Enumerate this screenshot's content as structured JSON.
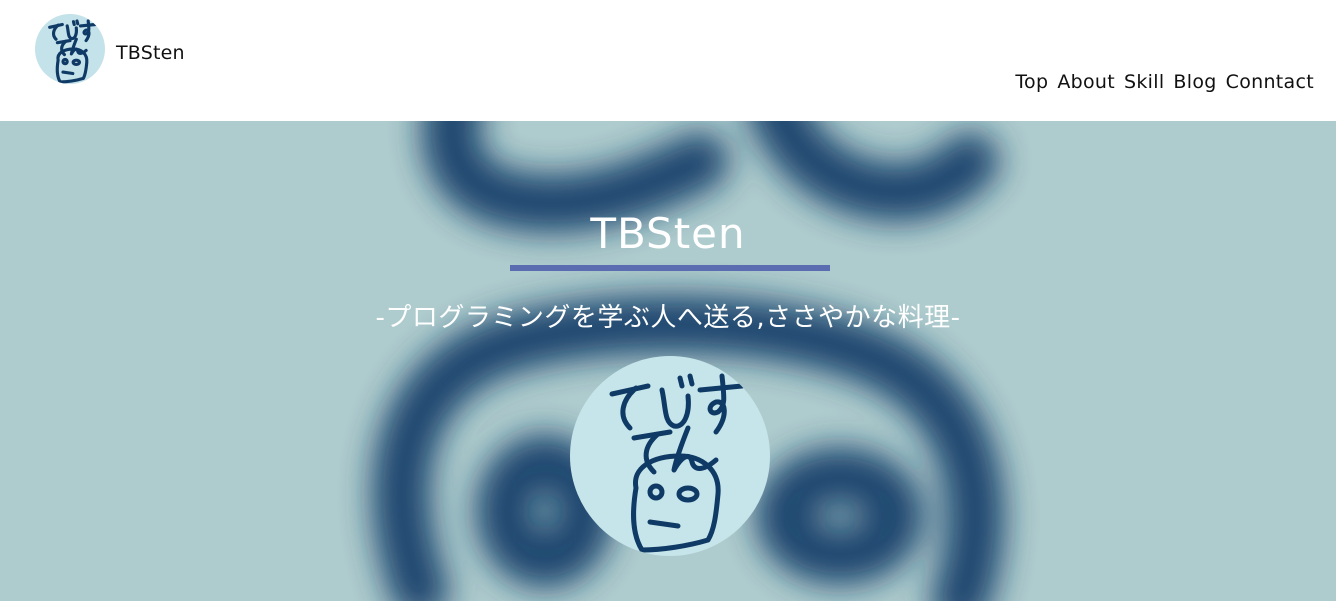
{
  "header": {
    "brand_name": "TBSten",
    "logo_icon": "tebisuten-face-icon"
  },
  "nav": {
    "items": [
      {
        "label": "Top"
      },
      {
        "label": "About"
      },
      {
        "label": "Skill"
      },
      {
        "label": "Blog"
      },
      {
        "label": "Conntact"
      }
    ]
  },
  "hero": {
    "title": "TBSten",
    "tagline": "-プログラミングを学ぶ人へ送る,ささやかな料理-",
    "avatar_icon": "tebisuten-face-icon"
  },
  "colors": {
    "hero_background": "#aecbcd",
    "underline": "#5b6db0",
    "ink": "#0f3a66",
    "avatar_background": "#c6e5ea"
  }
}
